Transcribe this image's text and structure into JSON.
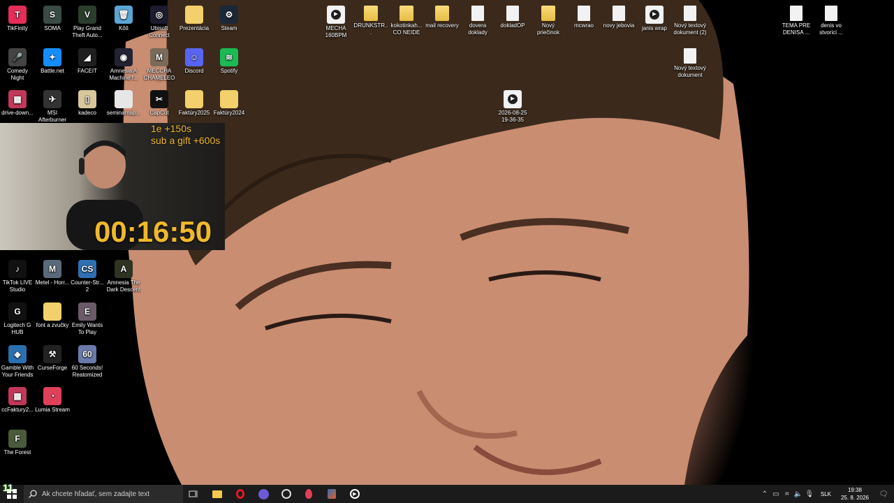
{
  "desktop": {
    "icons_left": [
      {
        "label": "TikFinity",
        "color": "#e52d57",
        "glyph": "T",
        "icon": "tikfinity-icon"
      },
      {
        "label": "SOMA",
        "color": "#3a4a44",
        "glyph": "S",
        "icon": "soma-icon"
      },
      {
        "label": "Play Grand Theft Auto...",
        "color": "#2b3d2b",
        "glyph": "V",
        "icon": "gta-icon"
      },
      {
        "label": "Kôš",
        "color": "#5aa6d6",
        "glyph": "🗑",
        "icon": "recycle-bin-icon"
      },
      {
        "label": "Ubisoft Connect",
        "color": "#1c1c2e",
        "glyph": "◎",
        "icon": "ubisoft-icon"
      },
      {
        "label": "Prezentácia",
        "color": "#f2d06b",
        "glyph": "",
        "icon": "folder-icon"
      },
      {
        "label": "Steam",
        "color": "#1b2838",
        "glyph": "⚙",
        "icon": "steam-icon"
      },
      {
        "label": "Comedy Night",
        "color": "#444",
        "glyph": "🎤",
        "icon": "comedy-night-icon"
      },
      {
        "label": "Battle.net",
        "color": "#148eff",
        "glyph": "✦",
        "icon": "battlenet-icon"
      },
      {
        "label": "FACEIT",
        "color": "#1f1f1f",
        "glyph": "◢",
        "icon": "faceit-icon"
      },
      {
        "label": "Amnesia A Machine f...",
        "color": "#223",
        "glyph": "◉",
        "icon": "amnesia-machine-icon"
      },
      {
        "label": "MECCHA CHAMELEON",
        "color": "#7a6a5a",
        "glyph": "M",
        "icon": "meccha-icon"
      },
      {
        "label": "Discord",
        "color": "#5865f2",
        "glyph": "☺",
        "icon": "discord-icon"
      },
      {
        "label": "Spotify",
        "color": "#1db954",
        "glyph": "≋",
        "icon": "spotify-icon"
      },
      {
        "label": "drive-down...",
        "color": "#c2385a",
        "glyph": "▦",
        "icon": "archive-icon"
      },
      {
        "label": "MSI Afterburner",
        "color": "#333",
        "glyph": "✈",
        "icon": "msi-afterburner-icon"
      },
      {
        "label": "kadeco",
        "color": "#d8c79a",
        "glyph": "▯",
        "icon": "file-icon"
      },
      {
        "label": "seminarnap...",
        "color": "#e6e6e6",
        "glyph": "",
        "icon": "image-file-icon"
      },
      {
        "label": "CapCut",
        "color": "#111",
        "glyph": "✂",
        "icon": "capcut-icon"
      },
      {
        "label": "Faktúry2025",
        "color": "#f2d06b",
        "glyph": "",
        "icon": "folder-icon"
      },
      {
        "label": "Faktúry2024",
        "color": "#f2d06b",
        "glyph": "",
        "icon": "folder-icon"
      },
      {
        "label": "TikTok LIVE Studio",
        "color": "#111",
        "glyph": "♪",
        "icon": "tiktok-live-icon"
      },
      {
        "label": "Metel - Horr...",
        "color": "#5a6a7a",
        "glyph": "M",
        "icon": "metel-icon"
      },
      {
        "label": "Counter-Str... 2",
        "color": "#2f6fb3",
        "glyph": "CS",
        "icon": "cs2-icon"
      },
      {
        "label": "Amnesia The Dark Descent",
        "color": "#2e3322",
        "glyph": "A",
        "icon": "amnesia-dd-icon"
      },
      {
        "label": "Logitech G HUB",
        "color": "#111",
        "glyph": "G",
        "icon": "logitech-icon"
      },
      {
        "label": "font a zvučky",
        "color": "#f2d06b",
        "glyph": "",
        "icon": "folder-icon"
      },
      {
        "label": "Emily Wants To Play",
        "color": "#6a5a6a",
        "glyph": "E",
        "icon": "emily-icon"
      },
      {
        "label": "Gamble With Your Friends",
        "color": "#2a6fb0",
        "glyph": "◈",
        "icon": "gamble-icon"
      },
      {
        "label": "CurseForge",
        "color": "#222",
        "glyph": "⚒",
        "icon": "curseforge-icon"
      },
      {
        "label": "60 Seconds! Reatomized",
        "color": "#6a7aaa",
        "glyph": "60",
        "icon": "60seconds-icon"
      },
      {
        "label": "ccFaktury2...",
        "color": "#c2385a",
        "glyph": "▦",
        "icon": "archive-icon"
      },
      {
        "label": "Lumia Stream",
        "color": "#e0405a",
        "glyph": "◔",
        "icon": "lumia-icon"
      },
      {
        "label": "The Forest",
        "color": "#4a5a3a",
        "glyph": "F",
        "icon": "the-forest-icon"
      }
    ],
    "icons_top": [
      {
        "label": "MECHA 160BPM PR...",
        "icon": "media-file-icon",
        "kind": "media"
      },
      {
        "label": "DRUNKSTR...",
        "icon": "folder-icon",
        "kind": "folder"
      },
      {
        "label": "kokotinkah... CO NEIDE",
        "icon": "folder-icon",
        "kind": "folder"
      },
      {
        "label": "mail recovery",
        "icon": "folder-icon",
        "kind": "folder"
      },
      {
        "label": "dovera doklady",
        "icon": "document-icon",
        "kind": "doc"
      },
      {
        "label": "dokladOP",
        "icon": "document-icon",
        "kind": "doc"
      },
      {
        "label": "Nový priečinok",
        "icon": "folder-icon",
        "kind": "folder"
      },
      {
        "label": "mcwrao",
        "icon": "document-icon",
        "kind": "doc"
      },
      {
        "label": "novy jebovia",
        "icon": "document-icon",
        "kind": "doc"
      },
      {
        "label": "janis wrap",
        "icon": "media-file-icon",
        "kind": "media"
      },
      {
        "label": "Nový textový dokument (2)",
        "icon": "text-document-icon",
        "kind": "doc"
      },
      {
        "label": "TEMA PRE DENISA ...",
        "icon": "text-document-icon",
        "kind": "doc"
      },
      {
        "label": "denis vo stvorici ...",
        "icon": "text-document-icon",
        "kind": "doc"
      },
      {
        "label": "Nový textový dokument",
        "icon": "text-document-icon",
        "kind": "doc"
      },
      {
        "label": "2026-08-25 19-36-35",
        "icon": "video-file-icon",
        "kind": "media"
      }
    ]
  },
  "webcam": {
    "subs_line1": "1e +150s",
    "subs_line2": "sub a gift +600s",
    "timer": "00:16:50"
  },
  "taskbar": {
    "start_badge": "11",
    "search_placeholder": "Ak chcete hľadať, sem zadajte text",
    "language": "SLK",
    "time": "19:38",
    "date": "25. 8. 2026"
  }
}
